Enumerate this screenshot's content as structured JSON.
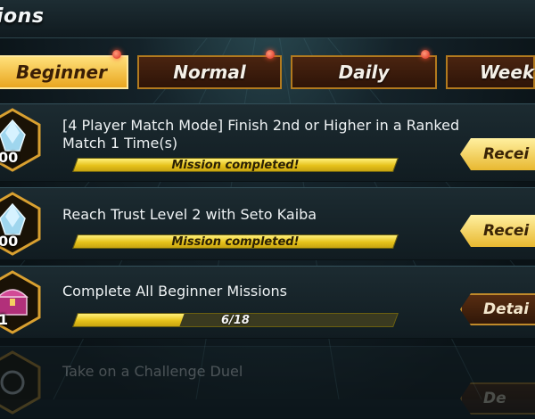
{
  "header": {
    "title": "ions"
  },
  "tabs": [
    {
      "label": "Beginner",
      "active": true,
      "notify": true
    },
    {
      "label": "Normal",
      "active": false,
      "notify": true
    },
    {
      "label": "Daily",
      "active": false,
      "notify": true
    },
    {
      "label": "Week",
      "active": false,
      "notify": false
    }
  ],
  "missions": [
    {
      "text": "[4 Player Match Mode] Finish 2nd or Higher in a Ranked\nMatch 1 Time(s)",
      "reward_icon": "gem-cluster-icon",
      "reward_count": "00",
      "progress_label": "Mission completed!",
      "progress": 1.0,
      "action": "Recei"
    },
    {
      "text": "Reach Trust Level 2 with Seto Kaiba",
      "reward_icon": "gem-cluster-icon",
      "reward_count": "00",
      "progress_label": "Mission completed!",
      "progress": 1.0,
      "action": "Recei"
    },
    {
      "text": "Complete All Beginner Missions",
      "reward_icon": "treasure-chest-icon",
      "reward_count": "1",
      "progress_label": "6/18",
      "progress": 0.333,
      "action": "Detai"
    },
    {
      "text": "Take on a Challenge Duel",
      "reward_icon": "medal-icon",
      "reward_count": "",
      "progress_label": "",
      "progress": 0,
      "action": "De"
    }
  ],
  "colors": {
    "accent_gold": "#e9a620",
    "tab_brown": "#2e1408",
    "bar_yellow": "#e6c21a"
  }
}
